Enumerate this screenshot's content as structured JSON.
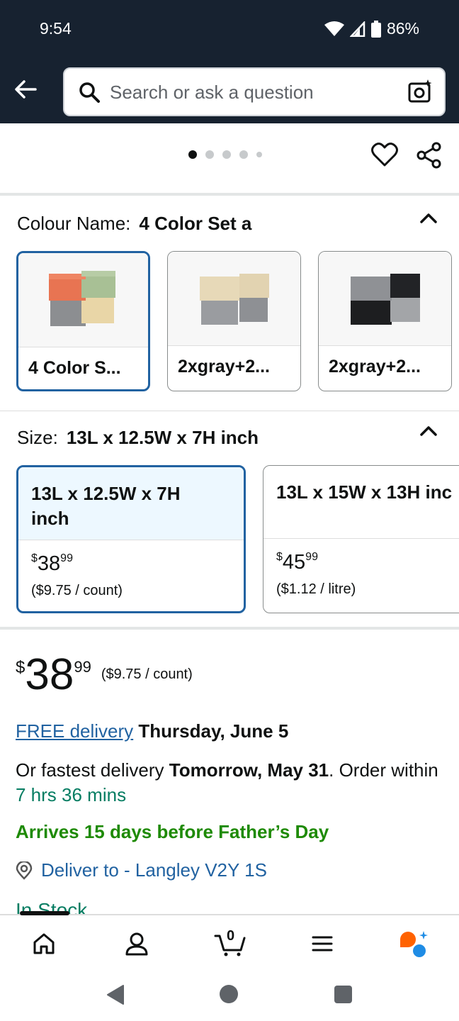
{
  "status_bar": {
    "time": "9:54",
    "battery": "86%"
  },
  "search": {
    "placeholder": "Search or ask a question"
  },
  "colour": {
    "label": "Colour Name:",
    "value": "4 Color Set a",
    "options": [
      {
        "label": "4 Color S..."
      },
      {
        "label": "2xgray+2..."
      },
      {
        "label": "2xgray+2..."
      }
    ]
  },
  "size": {
    "label": "Size:",
    "value": "13L x 12.5W x 7H inch",
    "options": [
      {
        "name": "13L x 12.5W x 7H inch",
        "price_symbol": "$",
        "price_whole": "38",
        "price_fraction": "99",
        "unit_price": "($9.75 / count)"
      },
      {
        "name": "13L x 15W x 13H inc",
        "price_symbol": "$",
        "price_whole": "45",
        "price_fraction": "99",
        "unit_price": "($1.12 / litre)"
      }
    ]
  },
  "price": {
    "symbol": "$",
    "whole": "38",
    "fraction": "99",
    "unit": "($9.75 / count)"
  },
  "delivery": {
    "free_link": "FREE delivery",
    "free_date": "Thursday, June 5",
    "fastest_prefix": "Or fastest delivery",
    "fastest_date": "Tomorrow, May 31",
    "order_within_prefix": ". Order within",
    "order_within_time": "7 hrs 36 mins",
    "arrives_note": "Arrives 15 days before Father’s Day",
    "deliver_to": "Deliver to - Langley V2Y 1S",
    "stock": "In Stock"
  },
  "cart_count": "0",
  "colors": {
    "header_bg": "#172230",
    "link": "#2162a1",
    "green": "#1e8a05",
    "teal": "#067d62",
    "selected_border": "#2162a1"
  }
}
